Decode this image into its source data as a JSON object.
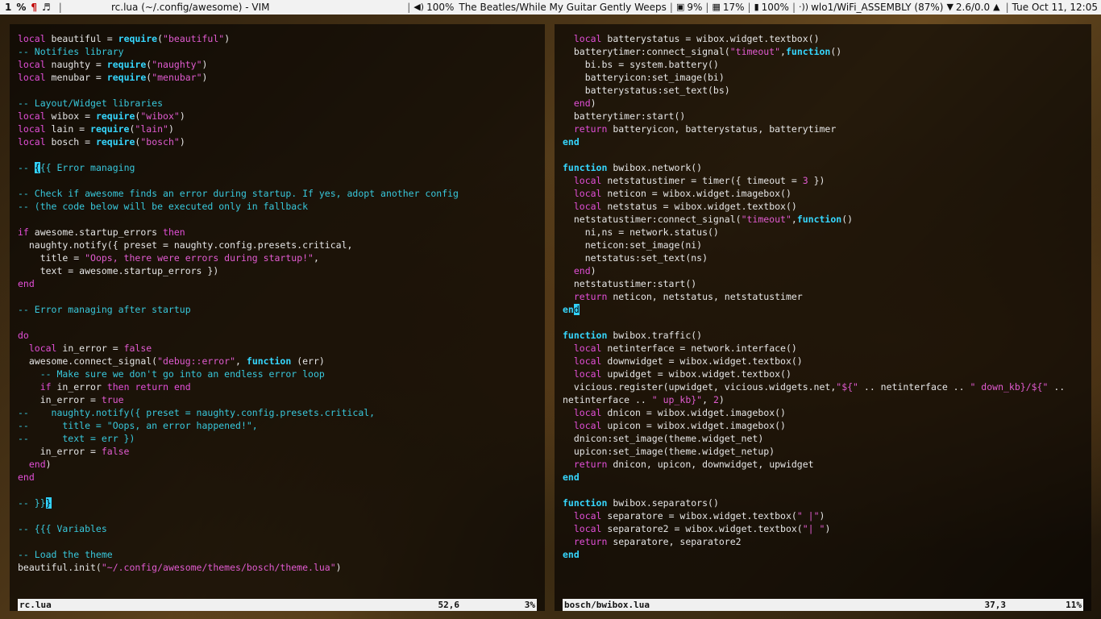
{
  "topbar": {
    "tags": [
      "1",
      "%",
      "¶",
      "♬"
    ],
    "window_title": "rc.lua (~/.config/awesome) - VIM",
    "volume": "100%",
    "now_playing": "The Beatles/While My Guitar Gently Weeps",
    "cpu": "9%",
    "mem": "17%",
    "battery": "100%",
    "wifi": "wlo1/WiFi_ASSEMBLY (87%)",
    "traffic": "2.6/0.0",
    "datetime": "Tue Oct 11, 12:05"
  },
  "left_pane": {
    "filename": "rc.lua",
    "position": "52,6",
    "percent": "3%",
    "lines": [
      [
        [
          "kw",
          "local"
        ],
        [
          "t",
          " beautiful = "
        ],
        [
          "fn",
          "require"
        ],
        [
          "t",
          "("
        ],
        [
          "str",
          "\"beautiful\""
        ],
        [
          "t",
          ")"
        ]
      ],
      [
        [
          "cm",
          "-- Notifies library"
        ]
      ],
      [
        [
          "kw",
          "local"
        ],
        [
          "t",
          " naughty = "
        ],
        [
          "fn",
          "require"
        ],
        [
          "t",
          "("
        ],
        [
          "str",
          "\"naughty\""
        ],
        [
          "t",
          ")"
        ]
      ],
      [
        [
          "kw",
          "local"
        ],
        [
          "t",
          " menubar = "
        ],
        [
          "fn",
          "require"
        ],
        [
          "t",
          "("
        ],
        [
          "str",
          "\"menubar\""
        ],
        [
          "t",
          ")"
        ]
      ],
      [],
      [
        [
          "cm",
          "-- Layout/Widget libraries"
        ]
      ],
      [
        [
          "kw",
          "local"
        ],
        [
          "t",
          " wibox = "
        ],
        [
          "fn",
          "require"
        ],
        [
          "t",
          "("
        ],
        [
          "str",
          "\"wibox\""
        ],
        [
          "t",
          ")"
        ]
      ],
      [
        [
          "kw",
          "local"
        ],
        [
          "t",
          " lain = "
        ],
        [
          "fn",
          "require"
        ],
        [
          "t",
          "("
        ],
        [
          "str",
          "\"lain\""
        ],
        [
          "t",
          ")"
        ]
      ],
      [
        [
          "kw",
          "local"
        ],
        [
          "t",
          " bosch = "
        ],
        [
          "fn",
          "require"
        ],
        [
          "t",
          "("
        ],
        [
          "str",
          "\"bosch\""
        ],
        [
          "t",
          ")"
        ]
      ],
      [],
      [
        [
          "cm",
          "-- "
        ],
        [
          "cursor",
          "{"
        ],
        [
          "cm",
          "{{ Error managing"
        ]
      ],
      [],
      [
        [
          "cm",
          "-- Check if awesome finds an error during startup. If yes, adopt another config"
        ]
      ],
      [
        [
          "cm",
          "-- (the code below will be executed only in fallback"
        ]
      ],
      [],
      [
        [
          "kw",
          "if"
        ],
        [
          "t",
          " awesome.startup_errors "
        ],
        [
          "kw",
          "then"
        ]
      ],
      [
        [
          "t",
          "  naughty.notify({ preset = naughty.config.presets.critical,"
        ]
      ],
      [
        [
          "t",
          "    title = "
        ],
        [
          "str",
          "\"Oops, there were errors during startup!\""
        ],
        [
          "t",
          ","
        ]
      ],
      [
        [
          "t",
          "    text = awesome.startup_errors })"
        ]
      ],
      [
        [
          "kw",
          "end"
        ]
      ],
      [],
      [
        [
          "cm",
          "-- Error managing after startup"
        ]
      ],
      [],
      [
        [
          "kw",
          "do"
        ]
      ],
      [
        [
          "t",
          "  "
        ],
        [
          "kw",
          "local"
        ],
        [
          "t",
          " in_error = "
        ],
        [
          "bool",
          "false"
        ]
      ],
      [
        [
          "t",
          "  awesome.connect_signal("
        ],
        [
          "str",
          "\"debug::error\""
        ],
        [
          "t",
          ", "
        ],
        [
          "fn",
          "function"
        ],
        [
          "t",
          " (err)"
        ]
      ],
      [
        [
          "cm",
          "    -- Make sure we don't go into an endless error loop"
        ]
      ],
      [
        [
          "t",
          "    "
        ],
        [
          "kw",
          "if"
        ],
        [
          "t",
          " in_error "
        ],
        [
          "kw",
          "then"
        ],
        [
          "t",
          " "
        ],
        [
          "kw",
          "return"
        ],
        [
          "t",
          " "
        ],
        [
          "kw",
          "end"
        ]
      ],
      [
        [
          "t",
          "    in_error = "
        ],
        [
          "bool",
          "true"
        ]
      ],
      [
        [
          "cm",
          "--    naughty.notify({ preset = naughty.config.presets.critical,"
        ]
      ],
      [
        [
          "cm",
          "--      title = \"Oops, an error happened!\","
        ]
      ],
      [
        [
          "cm",
          "--      text = err })"
        ]
      ],
      [
        [
          "t",
          "    in_error = "
        ],
        [
          "bool",
          "false"
        ]
      ],
      [
        [
          "t",
          "  "
        ],
        [
          "kw",
          "end"
        ],
        [
          "t",
          ")"
        ]
      ],
      [
        [
          "kw",
          "end"
        ]
      ],
      [],
      [
        [
          "cm",
          "-- }}"
        ],
        [
          "cursor",
          "}"
        ]
      ],
      [],
      [
        [
          "cm",
          "-- {{{ Variables"
        ]
      ],
      [],
      [
        [
          "cm",
          "-- Load the theme"
        ]
      ],
      [
        [
          "t",
          "beautiful.init("
        ],
        [
          "str",
          "\"~/.config/awesome/themes/bosch/theme.lua\""
        ],
        [
          "t",
          ")"
        ]
      ]
    ]
  },
  "right_pane": {
    "filename": "bosch/bwibox.lua",
    "position": "37,3",
    "percent": "11%",
    "lines": [
      [
        [
          "t",
          "  "
        ],
        [
          "kw",
          "local"
        ],
        [
          "t",
          " batterystatus = wibox.widget.textbox()"
        ]
      ],
      [
        [
          "t",
          "  batterytimer:connect_signal("
        ],
        [
          "str",
          "\"timeout\""
        ],
        [
          "t",
          ","
        ],
        [
          "fn",
          "function"
        ],
        [
          "t",
          "()"
        ]
      ],
      [
        [
          "t",
          "    bi.bs = system.battery()"
        ]
      ],
      [
        [
          "t",
          "    batteryicon:set_image(bi)"
        ]
      ],
      [
        [
          "t",
          "    batterystatus:set_text(bs)"
        ]
      ],
      [
        [
          "t",
          "  "
        ],
        [
          "kw",
          "end"
        ],
        [
          "t",
          ")"
        ]
      ],
      [
        [
          "t",
          "  batterytimer:start()"
        ]
      ],
      [
        [
          "t",
          "  "
        ],
        [
          "kw",
          "return"
        ],
        [
          "t",
          " batteryicon, batterystatus, batterytimer"
        ]
      ],
      [
        [
          "fn",
          "end"
        ]
      ],
      [],
      [
        [
          "fn",
          "function"
        ],
        [
          "t",
          " bwibox.network()"
        ]
      ],
      [
        [
          "t",
          "  "
        ],
        [
          "kw",
          "local"
        ],
        [
          "t",
          " netstatustimer = timer({ timeout = "
        ],
        [
          "num",
          "3"
        ],
        [
          "t",
          " })"
        ]
      ],
      [
        [
          "t",
          "  "
        ],
        [
          "kw",
          "local"
        ],
        [
          "t",
          " neticon = wibox.widget.imagebox()"
        ]
      ],
      [
        [
          "t",
          "  "
        ],
        [
          "kw",
          "local"
        ],
        [
          "t",
          " netstatus = wibox.widget.textbox()"
        ]
      ],
      [
        [
          "t",
          "  netstatustimer:connect_signal("
        ],
        [
          "str",
          "\"timeout\""
        ],
        [
          "t",
          ","
        ],
        [
          "fn",
          "function"
        ],
        [
          "t",
          "()"
        ]
      ],
      [
        [
          "t",
          "    ni,ns = network.status()"
        ]
      ],
      [
        [
          "t",
          "    neticon:set_image(ni)"
        ]
      ],
      [
        [
          "t",
          "    netstatus:set_text(ns)"
        ]
      ],
      [
        [
          "t",
          "  "
        ],
        [
          "kw",
          "end"
        ],
        [
          "t",
          ")"
        ]
      ],
      [
        [
          "t",
          "  netstatustimer:start()"
        ]
      ],
      [
        [
          "t",
          "  "
        ],
        [
          "kw",
          "return"
        ],
        [
          "t",
          " neticon, netstatus, netstatustimer"
        ]
      ],
      [
        [
          "fn",
          "en"
        ],
        [
          "cursor",
          "d"
        ]
      ],
      [],
      [
        [
          "fn",
          "function"
        ],
        [
          "t",
          " bwibox.traffic()"
        ]
      ],
      [
        [
          "t",
          "  "
        ],
        [
          "kw",
          "local"
        ],
        [
          "t",
          " netinterface = network.interface()"
        ]
      ],
      [
        [
          "t",
          "  "
        ],
        [
          "kw",
          "local"
        ],
        [
          "t",
          " downwidget = wibox.widget.textbox()"
        ]
      ],
      [
        [
          "t",
          "  "
        ],
        [
          "kw",
          "local"
        ],
        [
          "t",
          " upwidget = wibox.widget.textbox()"
        ]
      ],
      [
        [
          "t",
          "  vicious.register(upwidget, vicious.widgets.net,"
        ],
        [
          "str",
          "\"${\""
        ],
        [
          "t",
          " .. netinterface .. "
        ],
        [
          "str",
          "\" down_kb}/${\""
        ],
        [
          "t",
          " .."
        ]
      ],
      [
        [
          "t",
          "netinterface .. "
        ],
        [
          "str",
          "\" up_kb}\""
        ],
        [
          "t",
          ", "
        ],
        [
          "num",
          "2"
        ],
        [
          "t",
          ")"
        ]
      ],
      [
        [
          "t",
          "  "
        ],
        [
          "kw",
          "local"
        ],
        [
          "t",
          " dnicon = wibox.widget.imagebox()"
        ]
      ],
      [
        [
          "t",
          "  "
        ],
        [
          "kw",
          "local"
        ],
        [
          "t",
          " upicon = wibox.widget.imagebox()"
        ]
      ],
      [
        [
          "t",
          "  dnicon:set_image(theme.widget_net)"
        ]
      ],
      [
        [
          "t",
          "  upicon:set_image(theme.widget_netup)"
        ]
      ],
      [
        [
          "t",
          "  "
        ],
        [
          "kw",
          "return"
        ],
        [
          "t",
          " dnicon, upicon, downwidget, upwidget"
        ]
      ],
      [
        [
          "fn",
          "end"
        ]
      ],
      [],
      [
        [
          "fn",
          "function"
        ],
        [
          "t",
          " bwibox.separators()"
        ]
      ],
      [
        [
          "t",
          "  "
        ],
        [
          "kw",
          "local"
        ],
        [
          "t",
          " separatore = wibox.widget.textbox("
        ],
        [
          "str",
          "\" |\""
        ],
        [
          "t",
          ")"
        ]
      ],
      [
        [
          "t",
          "  "
        ],
        [
          "kw",
          "local"
        ],
        [
          "t",
          " separatore2 = wibox.widget.textbox("
        ],
        [
          "str",
          "\"| \""
        ],
        [
          "t",
          ")"
        ]
      ],
      [
        [
          "t",
          "  "
        ],
        [
          "kw",
          "return"
        ],
        [
          "t",
          " separatore, separatore2"
        ]
      ],
      [
        [
          "fn",
          "end"
        ]
      ]
    ]
  }
}
